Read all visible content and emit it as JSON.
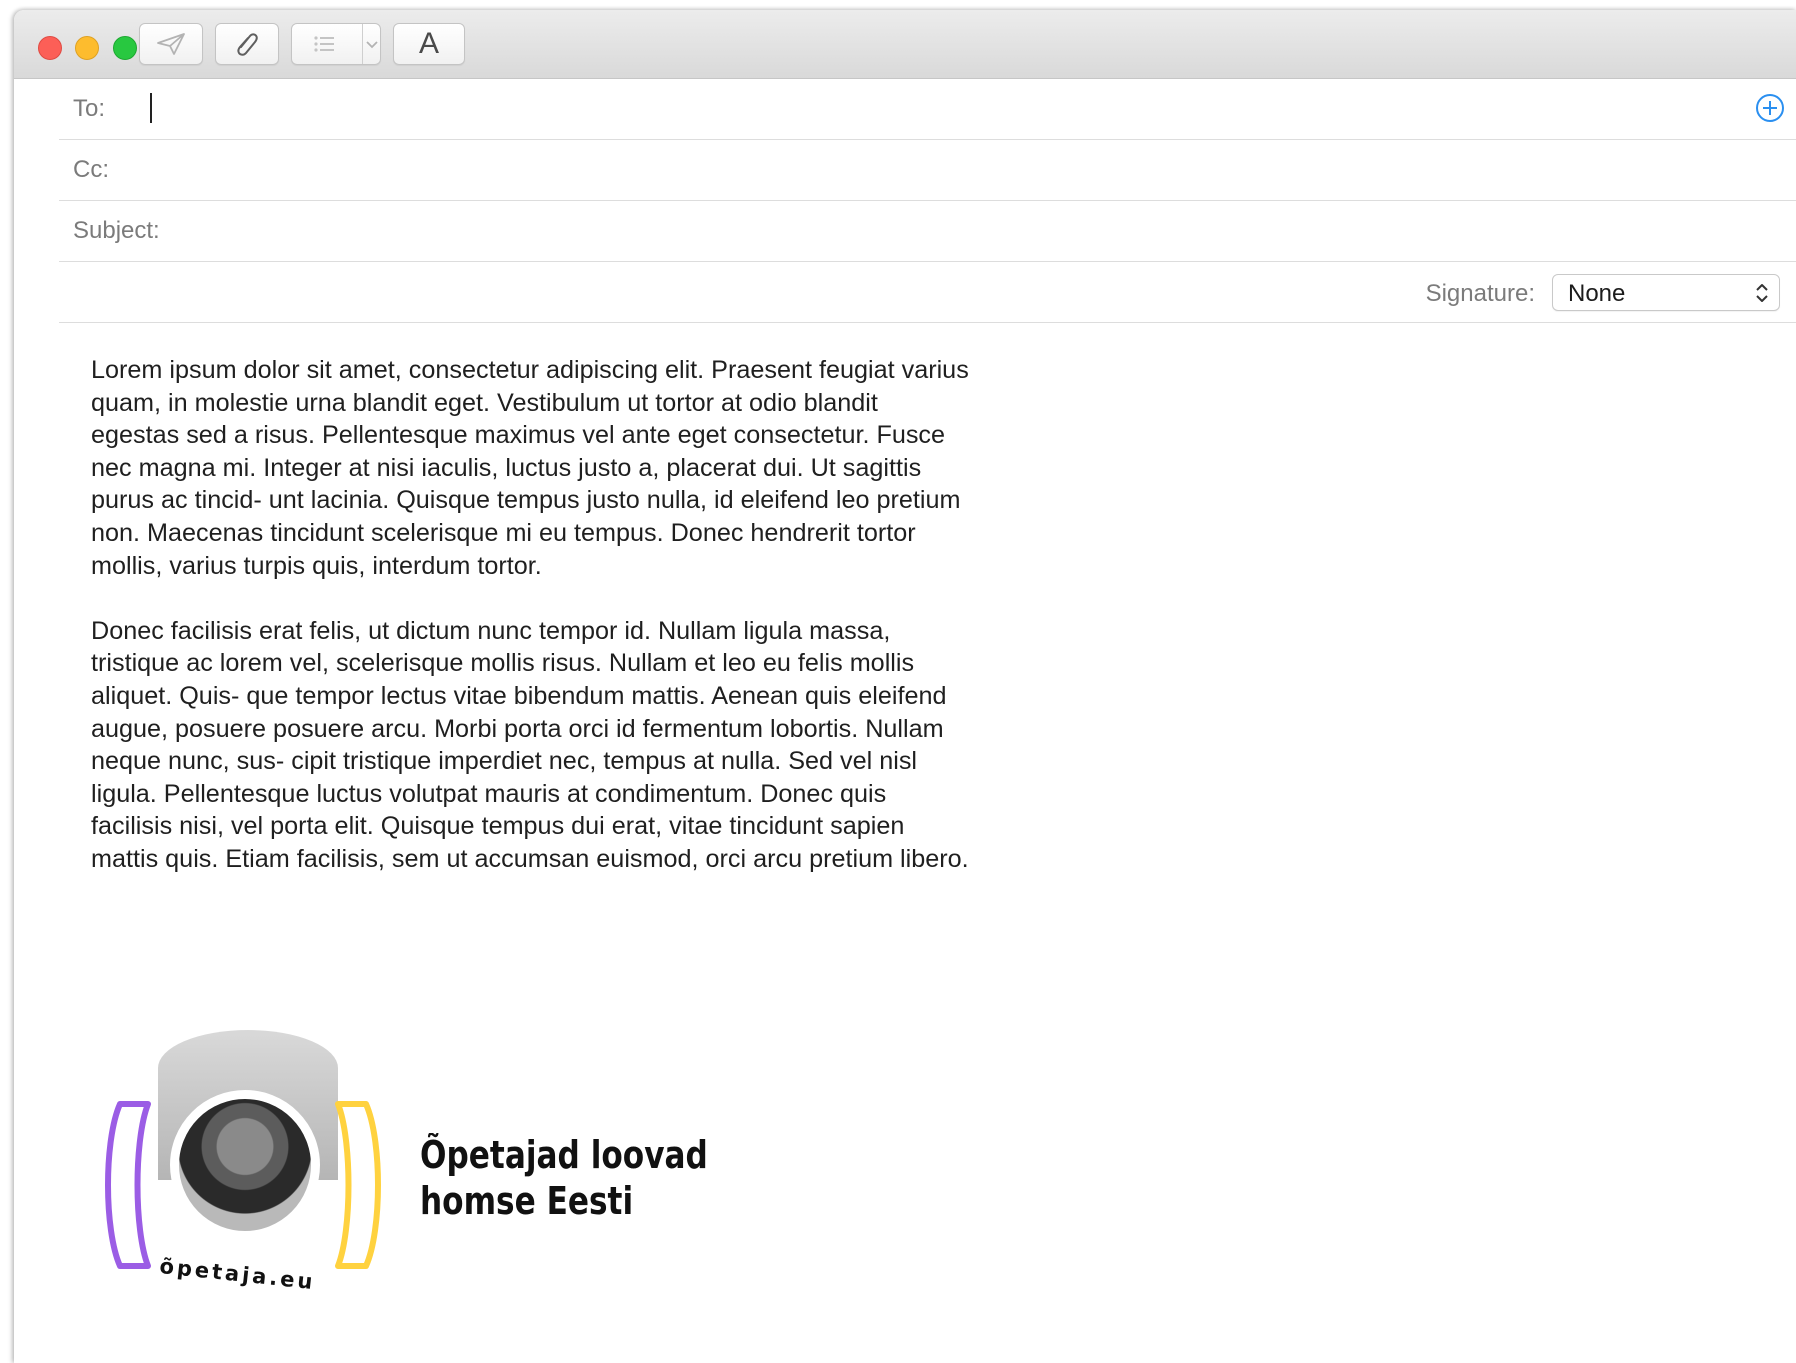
{
  "toolbar": {
    "send_icon": "paper-plane-icon",
    "attach_icon": "paperclip-icon",
    "list_icon": "list-icon",
    "dropdown_icon": "chevron-down-icon",
    "format_label": "A"
  },
  "header": {
    "to_label": "To:",
    "to_value": "",
    "cc_label": "Cc:",
    "cc_value": "",
    "subject_label": "Subject:",
    "subject_value": "",
    "signature_label": "Signature:",
    "signature_value": "None"
  },
  "message": {
    "paragraphs": [
      "Lorem ipsum dolor sit amet, consectetur adipiscing elit. Praesent feugiat varius quam, in molestie urna blandit eget. Vestibulum ut tortor at odio blandit egestas sed a risus. Pellentesque maximus vel ante eget consectetur. Fusce nec magna mi. Integer at nisi iaculis, luctus justo a, placerat dui. Ut sagittis purus ac tincid- unt lacinia. Quisque tempus justo nulla, id eleifend leo pretium non. Maecenas tincidunt scelerisque mi eu tempus. Donec hendrerit tortor mollis, varius turpis quis, interdum tortor.",
      "Donec facilisis erat felis, ut dictum nunc tempor id. Nullam ligula massa, tristique ac lorem vel, scelerisque mollis risus. Nullam et leo eu felis mollis aliquet. Quis- que tempor lectus vitae bibendum mattis. Aenean quis eleifend augue, posuere posuere arcu. Morbi porta orci id fermentum lobortis. Nullam neque nunc, sus- cipit tristique imperdiet nec, tempus at nulla. Sed vel nisl ligula. Pellentesque luctus volutpat mauris at condimentum. Donec quis facilisis nisi, vel porta elit. Quisque tempus dui erat, vitae tincidunt sapien mattis quis. Etiam facilisis, sem ut accumsan euismod, orci arcu pretium libero."
    ]
  },
  "signature": {
    "logo_text": "õpetaja.eu",
    "tagline_line1": "Õpetajad loovad",
    "tagline_line2": "homse Eesti",
    "colors": {
      "left_bracket": "#9b5de5",
      "right_bracket": "#ffd23f"
    }
  },
  "colors": {
    "accent": "#2a8ff0"
  }
}
